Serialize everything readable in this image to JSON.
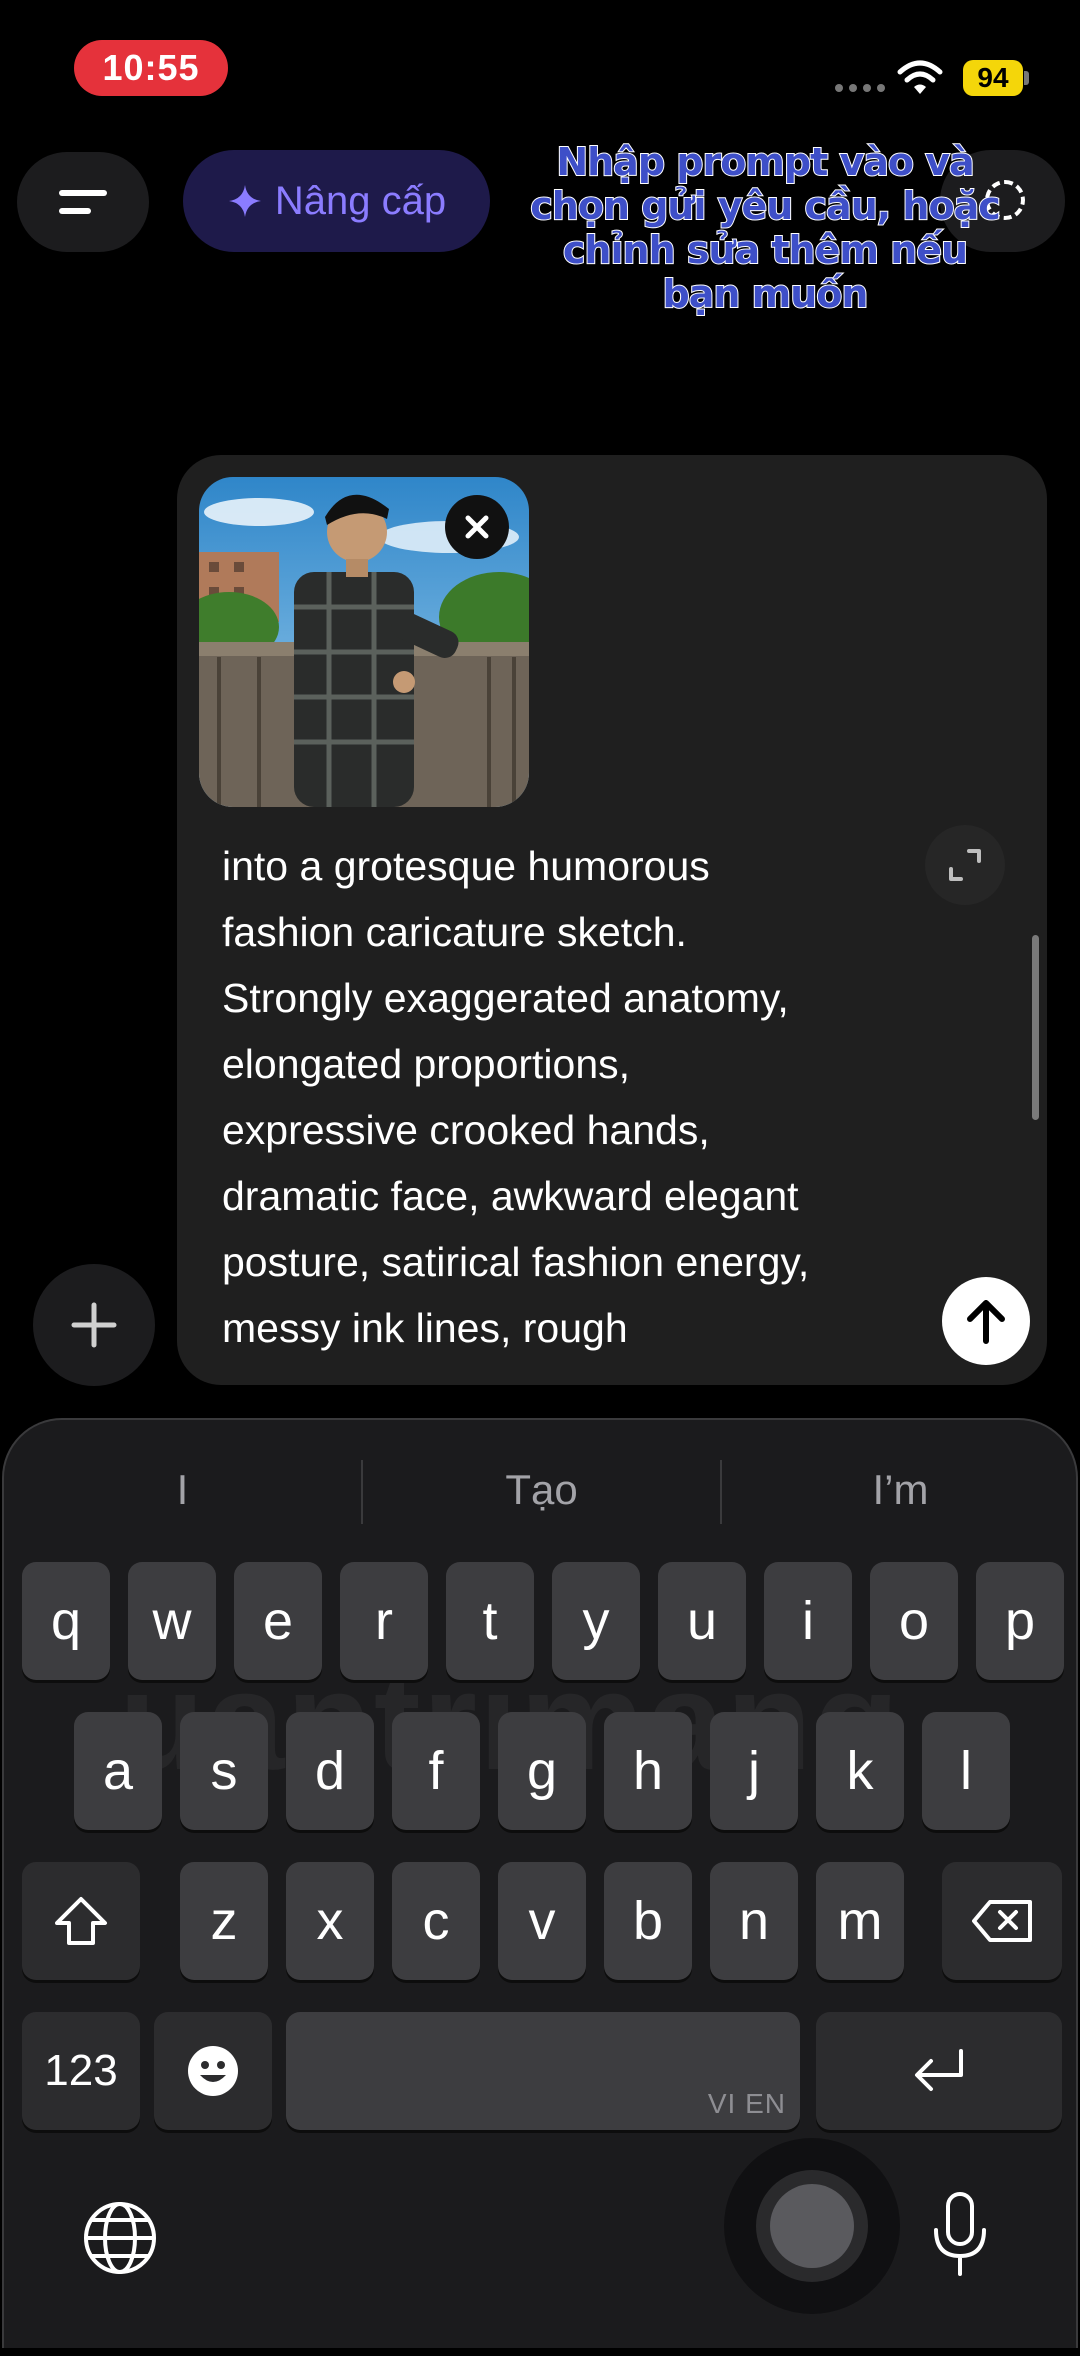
{
  "status_bar": {
    "time": "10:55",
    "battery": "94"
  },
  "top_bar": {
    "upgrade_label": "Nâng cấp"
  },
  "annotation": {
    "lines": [
      "Nhập prompt vào và",
      "chọn gửi yêu cầu, hoặc",
      "chỉnh sửa thêm nếu",
      "bạn muốn"
    ]
  },
  "composer": {
    "prompt_lines": [
      "into a grotesque humorous",
      "fashion caricature sketch.",
      "Strongly exaggerated anatomy,",
      "elongated proportions,",
      "expressive crooked hands,",
      "dramatic face, awkward elegant",
      "posture, satirical fashion energy,",
      "messy ink lines, rough"
    ]
  },
  "keyboard": {
    "suggestions": [
      "I",
      "Tạo",
      "I’m"
    ],
    "row1": [
      "q",
      "w",
      "e",
      "r",
      "t",
      "y",
      "u",
      "i",
      "o",
      "p"
    ],
    "row2": [
      "a",
      "s",
      "d",
      "f",
      "g",
      "h",
      "j",
      "k",
      "l"
    ],
    "row3": [
      "z",
      "x",
      "c",
      "v",
      "b",
      "n",
      "m"
    ],
    "numbers_label": "123",
    "space_lang": "VI EN",
    "watermark": "uantrimang"
  }
}
